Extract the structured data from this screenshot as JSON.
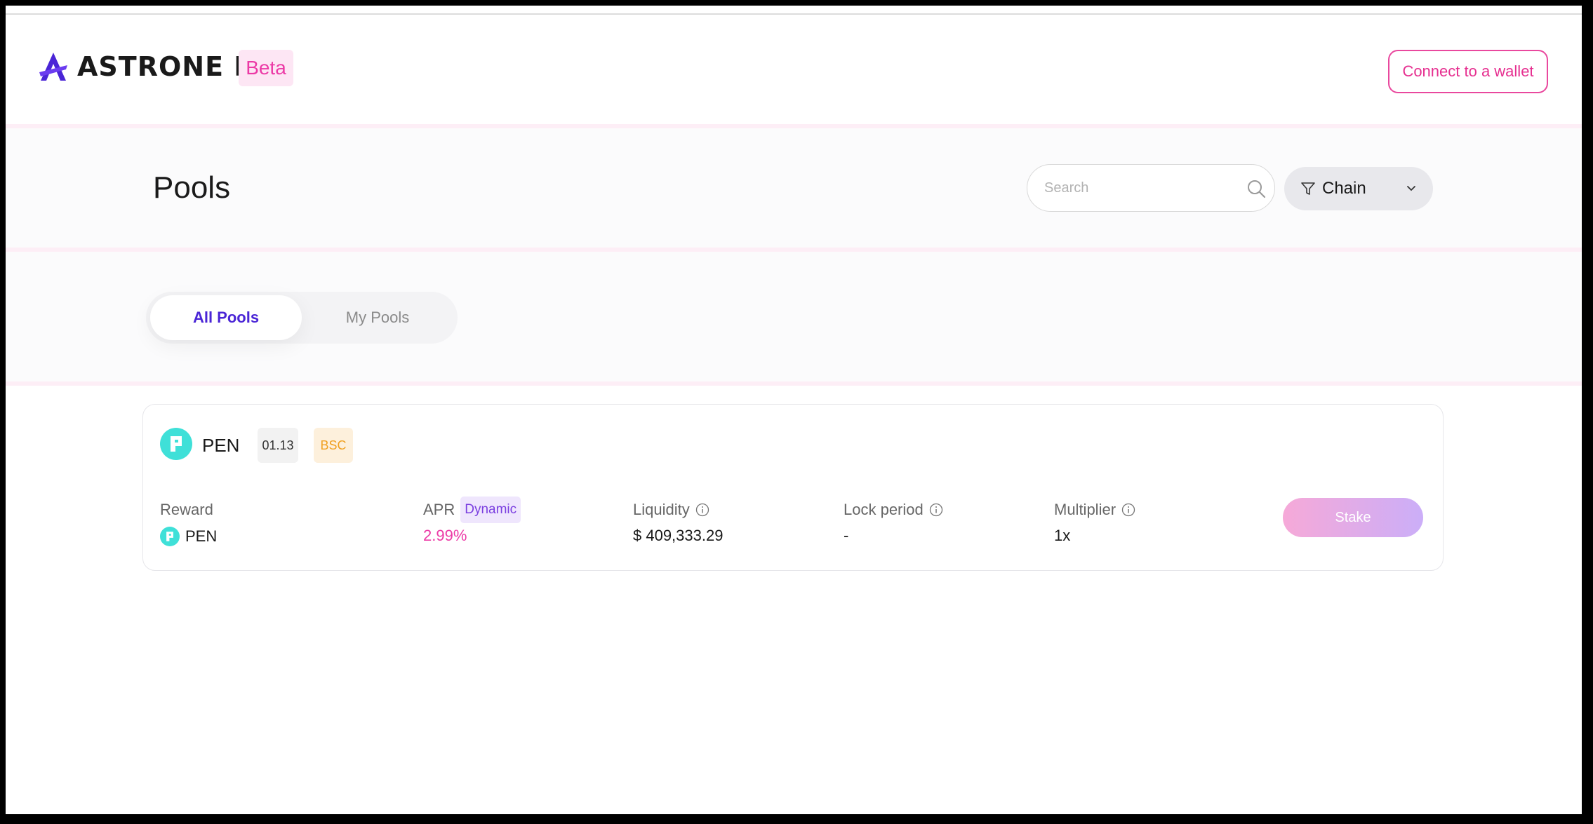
{
  "header": {
    "logo_text": "ASTRONE Fi",
    "beta_label": "Beta",
    "connect_label": "Connect to a wallet"
  },
  "page": {
    "title": "Pools"
  },
  "search": {
    "placeholder": "Search"
  },
  "chain_filter": {
    "label": "Chain"
  },
  "tabs": [
    {
      "label": "All Pools",
      "active": true
    },
    {
      "label": "My Pools",
      "active": false
    }
  ],
  "pool": {
    "token": "PEN",
    "version_badge": "01.13",
    "chain_badge": "BSC",
    "reward_label": "Reward",
    "reward_token": "PEN",
    "apr_label": "APR",
    "apr_badge": "Dynamic",
    "apr_value": "2.99%",
    "liquidity_label": "Liquidity",
    "liquidity_value": "$ 409,333.29",
    "lock_label": "Lock period",
    "lock_value": "-",
    "multiplier_label": "Multiplier",
    "multiplier_value": "1x",
    "stake_label": "Stake"
  },
  "colors": {
    "brand_purple": "#4a25d6",
    "brand_pink": "#ec3aa6",
    "token_teal": "#3fe0d8",
    "chain_badge_orange": "#f0a020"
  }
}
